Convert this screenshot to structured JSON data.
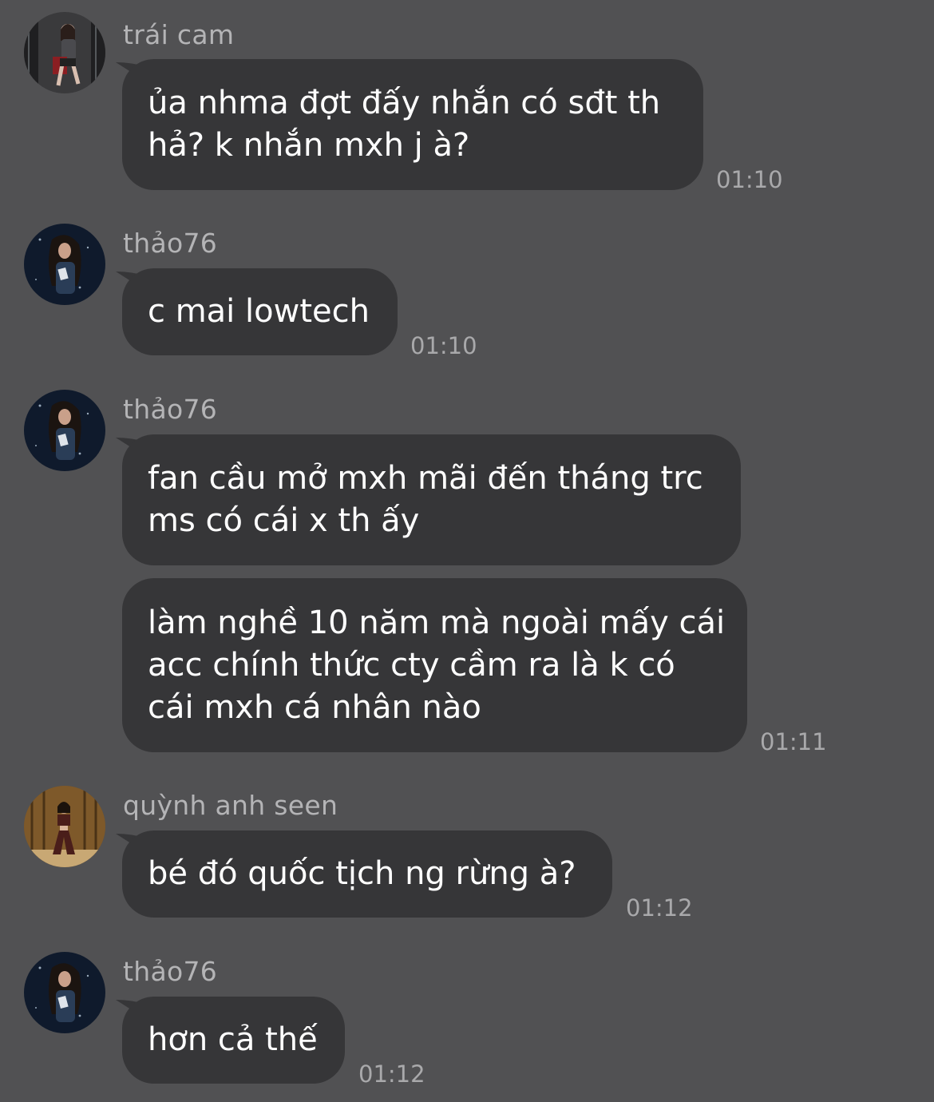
{
  "messages": [
    {
      "sender": "trái cam",
      "avatar": "avatar-trai-cam",
      "bubbles": [
        {
          "lines": [
            "ủa nhma đợt đấy nhắn có sđt th",
            "hả? k nhắn mxh j à?"
          ]
        }
      ],
      "time": "01:10"
    },
    {
      "sender": "thảo76",
      "avatar": "avatar-thao76",
      "bubbles": [
        {
          "lines": [
            "c mai lowtech"
          ]
        }
      ],
      "time": "01:10"
    },
    {
      "sender": "thảo76",
      "avatar": "avatar-thao76",
      "bubbles": [
        {
          "lines": [
            "fan cầu mở mxh mãi đến tháng trc",
            "ms có cái x th ấy"
          ]
        },
        {
          "lines": [
            "làm nghề 10 năm mà ngoài mấy cái",
            "acc chính thức cty cầm ra là k có",
            "cái mxh cá nhân nào"
          ]
        }
      ],
      "time": "01:11"
    },
    {
      "sender": "quỳnh anh seen",
      "avatar": "avatar-quynh-anh",
      "bubbles": [
        {
          "lines": [
            "bé đó quốc tịch ng rừng à?"
          ]
        }
      ],
      "time": "01:12"
    },
    {
      "sender": "thảo76",
      "avatar": "avatar-thao76",
      "bubbles": [
        {
          "lines": [
            "hơn cả thế"
          ]
        }
      ],
      "time": "01:12"
    }
  ]
}
